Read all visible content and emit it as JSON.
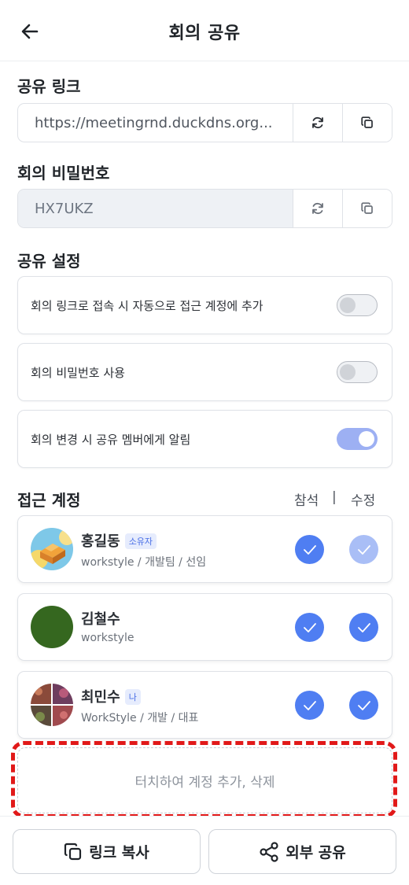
{
  "header": {
    "title": "회의 공유",
    "back_icon": "arrow-left-icon"
  },
  "share_link": {
    "title": "공유 링크",
    "value": "https://meetingrnd.duckdns.org...",
    "refresh_icon": "refresh-icon",
    "copy_icon": "copy-icon"
  },
  "password": {
    "title": "회의 비밀번호",
    "value": "HX7UKZ",
    "refresh_icon": "refresh-icon",
    "copy_icon": "copy-icon"
  },
  "settings": {
    "title": "공유 설정",
    "items": [
      {
        "label": "회의 링크로 접속 시 자동으로 접근 계정에 추가",
        "enabled": false
      },
      {
        "label": "회의 비밀번호 사용",
        "enabled": false
      },
      {
        "label": "회의 변경 시 공유 멤버에게 알림",
        "enabled": true
      }
    ]
  },
  "access": {
    "title": "접근 계정",
    "col_attend": "참석",
    "col_separator": "|",
    "col_edit": "수정",
    "members": [
      {
        "name": "홍길동",
        "badge": "소유자",
        "sub": "workstyle / 개발팀 / 선임",
        "attend": true,
        "edit": true
      },
      {
        "name": "김철수",
        "badge": "",
        "sub": "workstyle",
        "attend": true,
        "edit": true
      },
      {
        "name": "최민수",
        "badge": "나",
        "sub": "WorkStyle / 개발 / 대표",
        "attend": true,
        "edit": true
      }
    ],
    "add_hint": "터치하여 계정 추가, 삭제"
  },
  "bottom": {
    "copy_link_label": "링크 복사",
    "external_share_label": "외부 공유"
  },
  "colors": {
    "accent": "#4f7ef2",
    "accent_dim": "#a9bef6",
    "highlight": "#e11919"
  }
}
